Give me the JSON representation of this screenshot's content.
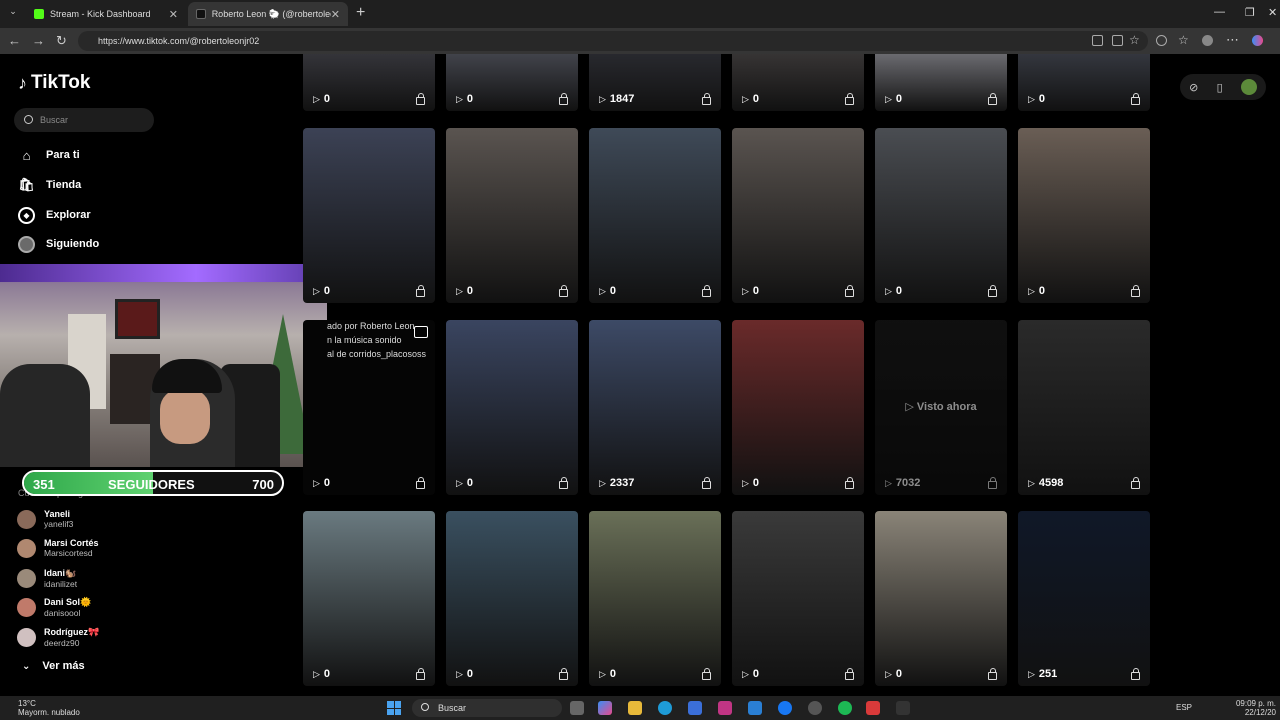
{
  "browser": {
    "tabs": [
      {
        "title": "Stream - Kick Dashboard",
        "favicon_color": "#53fc18"
      },
      {
        "title": "Roberto Leon 🐑 (@robertoleonjr",
        "favicon_color": "#111111"
      }
    ],
    "url": "https://www.tiktok.com/@robertoleonjr02"
  },
  "sidebar": {
    "logo": "TikTok",
    "search_placeholder": "Buscar",
    "nav": [
      {
        "label": "Para ti",
        "icon": "home-icon"
      },
      {
        "label": "Tienda",
        "icon": "shop-icon"
      },
      {
        "label": "Explorar",
        "icon": "compass-icon"
      },
      {
        "label": "Siguiendo",
        "icon": "avatar"
      }
    ],
    "following_title": "Cuentas que sigues",
    "accounts": [
      {
        "name": "Yaneli",
        "username": "yanelif3",
        "color": "#8a6a5a"
      },
      {
        "name": "Marsi Cortés",
        "username": "Marsicortesd",
        "color": "#b08870"
      },
      {
        "name": "Idani🐿️",
        "username": "idanilizet",
        "color": "#9a8a7a"
      },
      {
        "name": "Dani Sol🌞",
        "username": "danisoool",
        "color": "#c07a6a"
      },
      {
        "name": "Rodríguez🎀",
        "username": "deerdz90",
        "color": "#d0c0c0"
      }
    ],
    "see_more": "Ver más"
  },
  "overlay": {
    "followers": {
      "current": "351",
      "label": "SEGUIDORES",
      "goal": "700",
      "progress": 0.5
    }
  },
  "grid": {
    "row0": [
      {
        "views": "0"
      },
      {
        "views": "0"
      },
      {
        "views": "1847"
      },
      {
        "views": "0"
      },
      {
        "views": "0"
      },
      {
        "views": "0"
      }
    ],
    "row1": [
      {
        "views": "0"
      },
      {
        "views": "0"
      },
      {
        "views": "0"
      },
      {
        "views": "0"
      },
      {
        "views": "0"
      },
      {
        "views": "0"
      }
    ],
    "row2": [
      {
        "views": "0"
      },
      {
        "views": "0"
      },
      {
        "views": "2337"
      },
      {
        "views": "0"
      },
      {
        "views": "7032"
      },
      {
        "views": "4598"
      }
    ],
    "row3": [
      {
        "views": "0"
      },
      {
        "views": "0"
      },
      {
        "views": "0"
      },
      {
        "views": "0"
      },
      {
        "views": "0"
      },
      {
        "views": "251"
      }
    ],
    "watched_label": "Visto ahora",
    "caption": "ado por Roberto Leon\nn la música sonido\nal de corridos_placososs"
  },
  "taskbar": {
    "weather_temp": "13°C",
    "weather_desc": "Mayorm. nublado",
    "search": "Buscar",
    "lang": "ESP",
    "time": "09:09 p. m.",
    "date": "22/12/20"
  }
}
